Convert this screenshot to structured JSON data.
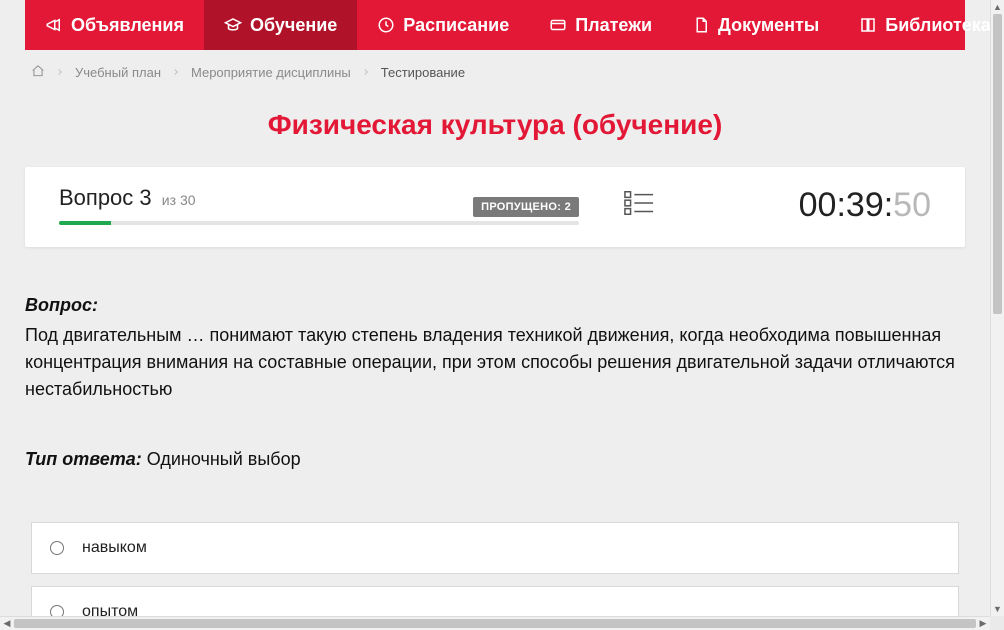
{
  "nav": {
    "items": [
      {
        "label": "Объявления",
        "active": false
      },
      {
        "label": "Обучение",
        "active": true
      },
      {
        "label": "Расписание",
        "active": false
      },
      {
        "label": "Платежи",
        "active": false
      },
      {
        "label": "Документы",
        "active": false
      },
      {
        "label": "Библиотека",
        "active": false,
        "dropdown": true
      }
    ]
  },
  "breadcrumb": {
    "items": [
      "Учебный план",
      "Мероприятие дисциплины",
      "Тестирование"
    ]
  },
  "title": "Физическая культура (обучение)",
  "status": {
    "question_prefix": "Вопрос",
    "question_num": "3",
    "question_of_prefix": "из",
    "question_total": "30",
    "skipped_label": "ПРОПУЩЕНО: 2",
    "progress_percent": 10,
    "timer_main": "00:39:",
    "timer_tail": "50"
  },
  "question": {
    "label": "Вопрос:",
    "text": "Под двигательным … понимают такую степень владения техникой движения, когда необходима повышенная концентрация внимания на составные операции, при этом способы решения двигательной задачи отличаются нестабильностью",
    "answer_type_label": "Тип ответа:",
    "answer_type_value": "Одиночный выбор"
  },
  "answers": [
    {
      "label": "навыком"
    },
    {
      "label": "опытом"
    }
  ]
}
